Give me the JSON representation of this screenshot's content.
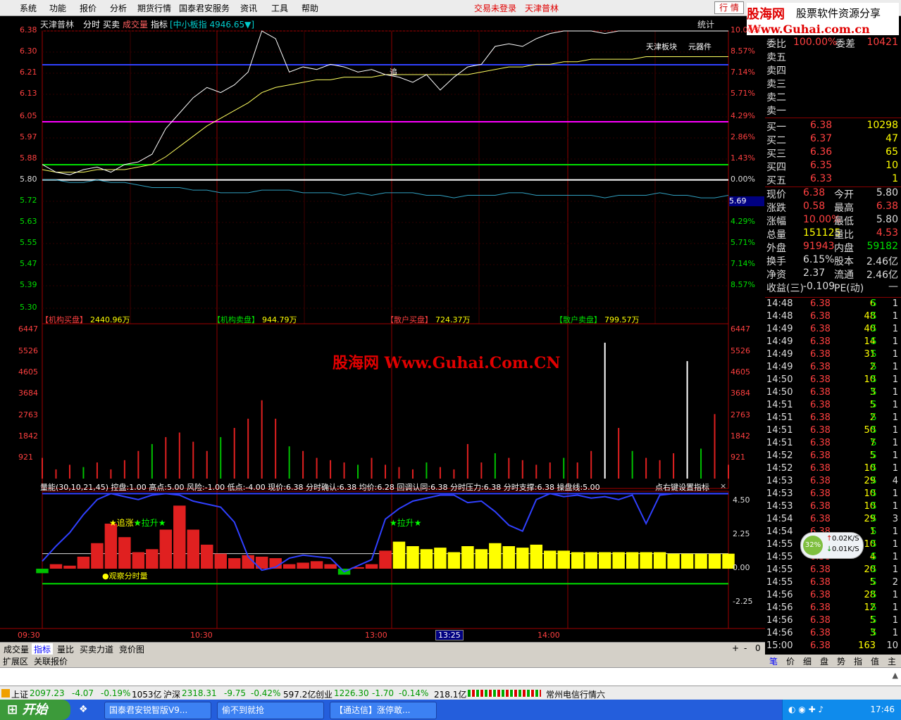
{
  "menu": {
    "items": [
      "系统",
      "功能",
      "报价",
      "分析",
      "期货行情",
      "国泰君安服务",
      "资讯",
      "工具",
      "帮助"
    ],
    "status1": "交易未登录",
    "status2": "天津普林",
    "hq_button": "行 情"
  },
  "logo": {
    "line1": "股海网",
    "line1b": "股票软件资源分享",
    "line2": "Www.Guhai.com.cn"
  },
  "chart": {
    "stock_name": "天津普林",
    "tabs": [
      "分时",
      "买卖",
      "成交量",
      "指标"
    ],
    "index_label": "[中小板指 4946.65▼]",
    "stat_label": "统计",
    "right_labels": [
      "天津板块",
      "元器件"
    ],
    "zhui": "追",
    "price_ticks": [
      "6.38",
      "6.30",
      "6.21",
      "6.13",
      "6.05",
      "5.97",
      "5.88",
      "5.80",
      "5.72",
      "5.63",
      "5.55",
      "5.47",
      "5.39",
      "5.30"
    ],
    "pct_ticks": [
      "10.00%",
      "8.57%",
      "7.14%",
      "5.71%",
      "4.29%",
      "2.86%",
      "1.43%",
      "0.00%",
      "2.86%",
      "4.29%",
      "5.71%",
      "7.14%",
      "8.57%"
    ],
    "cur_value": "5.69",
    "flows": [
      {
        "label": "【机构买盘】",
        "value": "2440.96万",
        "color": "#ff4040"
      },
      {
        "label": "【机构卖盘】",
        "value": "944.79万",
        "color": "#00e000"
      },
      {
        "label": "【散户买盘】",
        "value": "724.37万",
        "color": "#ff4040"
      },
      {
        "label": "【散户卖盘】",
        "value": "799.57万",
        "color": "#00e000"
      }
    ],
    "vol_ticks": [
      "6447",
      "5526",
      "4605",
      "3684",
      "2763",
      "1842",
      "921"
    ],
    "watermark": "股海网 Www.Guhai.Com.CN",
    "indicator_line": "量能(30,10,21,45) 控盘:1.00 高点:5.00 风险:-1.00 低点:-4.00 现价:6.38 分时确认:6.38 均价:6.28 回调认同:6.38 分时压力:6.38 分时支撑:6.38 操盘线:5.00",
    "indicator_hint": "点右键设置指标",
    "ind_ticks": [
      "4.50",
      "2.25",
      "0.00",
      "-2.25"
    ],
    "ind_labels": {
      "zhuizhang": "★追涨★",
      "lasheng1": "★拉升★",
      "lasheng2": "★拉升★",
      "guancha": "●观察分时量"
    },
    "time_labels": [
      "09:30",
      "10:30",
      "13:00",
      "13:25",
      "14:00"
    ]
  },
  "chart_data": {
    "type": "line",
    "title": "",
    "price_range": [
      5.3,
      6.38
    ],
    "prev_close": 5.8,
    "ind_range": [
      -3.4,
      5.2
    ],
    "price": [
      5.86,
      5.83,
      5.82,
      5.84,
      5.85,
      5.83,
      5.86,
      5.87,
      5.9,
      6.0,
      6.06,
      6.12,
      6.16,
      6.14,
      6.17,
      6.22,
      6.38,
      6.35,
      6.22,
      6.24,
      6.23,
      6.25,
      6.24,
      6.22,
      6.23,
      6.21,
      6.2,
      6.18,
      6.21,
      6.15,
      6.2,
      6.24,
      6.25,
      6.32,
      6.33,
      6.32,
      6.35,
      6.37,
      6.38,
      6.38,
      6.38,
      6.37,
      6.38,
      6.38,
      6.38,
      6.38,
      6.38,
      6.38,
      6.38,
      6.38,
      6.38
    ],
    "avg": [
      5.84,
      5.83,
      5.83,
      5.83,
      5.84,
      5.84,
      5.84,
      5.85,
      5.86,
      5.89,
      5.93,
      5.97,
      6.01,
      6.04,
      6.07,
      6.1,
      6.14,
      6.16,
      6.17,
      6.18,
      6.19,
      6.19,
      6.2,
      6.2,
      6.2,
      6.21,
      6.21,
      6.21,
      6.21,
      6.21,
      6.21,
      6.21,
      6.22,
      6.23,
      6.24,
      6.24,
      6.25,
      6.25,
      6.26,
      6.26,
      6.27,
      6.27,
      6.27,
      6.27,
      6.28,
      6.28,
      6.28,
      6.28,
      6.28,
      6.28,
      6.28
    ],
    "index_line": [
      5.8,
      5.8,
      5.79,
      5.79,
      5.8,
      5.79,
      5.79,
      5.78,
      5.77,
      5.77,
      5.77,
      5.76,
      5.76,
      5.75,
      5.75,
      5.75,
      5.76,
      5.76,
      5.76,
      5.75,
      5.75,
      5.75,
      5.74,
      5.75,
      5.74,
      5.75,
      5.75,
      5.75,
      5.74,
      5.74,
      5.73,
      5.74,
      5.74,
      5.74,
      5.75,
      5.75,
      5.74,
      5.74,
      5.74,
      5.74,
      5.74,
      5.73,
      5.74,
      5.74,
      5.74,
      5.75,
      5.74,
      5.74,
      5.73,
      5.73,
      5.74
    ],
    "volume": [
      900,
      400,
      600,
      500,
      700,
      400,
      800,
      1200,
      1500,
      1800,
      2000,
      1600,
      1200,
      1800,
      2200,
      2600,
      3400,
      2600,
      1400,
      1200,
      900,
      800,
      700,
      600,
      900,
      600,
      500,
      400,
      700,
      500,
      400,
      1500,
      700,
      1100,
      900,
      800,
      600,
      700,
      900,
      700,
      1200,
      5900,
      2200,
      1200,
      900,
      800,
      1100,
      5100,
      1300,
      2800,
      600
    ],
    "ind_blue": [
      0.5,
      1.5,
      2.4,
      3.6,
      4.6,
      5.0,
      4.8,
      4.6,
      4.9,
      5.0,
      4.9,
      4.5,
      4.3,
      4.1,
      3.1,
      0.8,
      -0.1,
      0.1,
      0.7,
      0.9,
      0.8,
      0.7,
      -0.2,
      0.2,
      0.6,
      3.3,
      4.0,
      4.5,
      4.7,
      4.9,
      4.9,
      4.4,
      4.5,
      3.8,
      2.9,
      2.5,
      4.6,
      5.0,
      4.8,
      4.9,
      4.7,
      4.8,
      4.6,
      4.9,
      3.0,
      4.9,
      5.0,
      5.0,
      5.0,
      5.0,
      5.0
    ],
    "ind_bars": [
      -0.3,
      0.3,
      0.2,
      0.8,
      1.7,
      3.0,
      2.1,
      1.1,
      1.3,
      2.6,
      4.2,
      2.6,
      1.6,
      1.0,
      0.7,
      0.9,
      0.8,
      0.7,
      0.3,
      0.4,
      0.5,
      0.3,
      -0.4,
      0.1,
      0.3,
      1.2,
      1.8,
      1.5,
      1.3,
      1.4,
      1.1,
      1.5,
      1.3,
      1.7,
      1.5,
      1.4,
      1.6,
      1.2,
      1.2,
      1.1,
      1.1,
      1.1,
      1.1,
      1.1,
      1.1,
      1.1,
      1.0,
      1.0,
      1.0,
      1.0,
      1.0
    ]
  },
  "quote": {
    "weibi": {
      "l1": "委比",
      "v1": "100.00%",
      "l2": "委差",
      "v2": "10421"
    },
    "asks": [
      {
        "label": "卖五",
        "price": "",
        "vol": ""
      },
      {
        "label": "卖四",
        "price": "",
        "vol": ""
      },
      {
        "label": "卖三",
        "price": "",
        "vol": ""
      },
      {
        "label": "卖二",
        "price": "",
        "vol": ""
      },
      {
        "label": "卖一",
        "price": "",
        "vol": ""
      }
    ],
    "bids": [
      {
        "label": "买一",
        "price": "6.38",
        "vol": "10298"
      },
      {
        "label": "买二",
        "price": "6.37",
        "vol": "47"
      },
      {
        "label": "买三",
        "price": "6.36",
        "vol": "65"
      },
      {
        "label": "买四",
        "price": "6.35",
        "vol": "10"
      },
      {
        "label": "买五",
        "price": "6.33",
        "vol": "1"
      }
    ],
    "stats": [
      {
        "l1": "现价",
        "v1": "6.38",
        "c1": "rd",
        "l2": "今开",
        "v2": "5.80",
        "c2": "wh"
      },
      {
        "l1": "涨跌",
        "v1": "0.58",
        "c1": "rd",
        "l2": "最高",
        "v2": "6.38",
        "c2": "rd"
      },
      {
        "l1": "涨幅",
        "v1": "10.00%",
        "c1": "rd",
        "l2": "最低",
        "v2": "5.80",
        "c2": "wh"
      },
      {
        "l1": "总量",
        "v1": "151125",
        "c1": "yel",
        "l2": "量比",
        "v2": "4.53",
        "c2": "rd"
      },
      {
        "l1": "外盘",
        "v1": "91943",
        "c1": "rd",
        "l2": "内盘",
        "v2": "59182",
        "c2": "gr"
      },
      {
        "l1": "换手",
        "v1": "6.15%",
        "c1": "wh",
        "l2": "股本",
        "v2": "2.46亿",
        "c2": "wh"
      },
      {
        "l1": "净资",
        "v1": "2.37",
        "c1": "wh",
        "l2": "流通",
        "v2": "2.46亿",
        "c2": "wh"
      },
      {
        "l1": "收益(三)",
        "v1": "-0.109",
        "c1": "wh",
        "l2": "PE(动)",
        "v2": "—",
        "c2": "wh"
      }
    ],
    "ticks": [
      {
        "t": "14:48",
        "p": "6.38",
        "v": "6",
        "s": "S",
        "n": "1"
      },
      {
        "t": "14:48",
        "p": "6.38",
        "v": "48",
        "s": "S",
        "n": "1"
      },
      {
        "t": "14:49",
        "p": "6.38",
        "v": "40",
        "s": "S",
        "n": "1"
      },
      {
        "t": "14:49",
        "p": "6.38",
        "v": "14",
        "s": "S",
        "n": "1"
      },
      {
        "t": "14:49",
        "p": "6.38",
        "v": "31",
        "s": "S",
        "n": "1"
      },
      {
        "t": "14:49",
        "p": "6.38",
        "v": "2",
        "s": "S",
        "n": "1"
      },
      {
        "t": "14:50",
        "p": "6.38",
        "v": "10",
        "s": "S",
        "n": "1"
      },
      {
        "t": "14:50",
        "p": "6.38",
        "v": "3",
        "s": "S",
        "n": "1"
      },
      {
        "t": "14:51",
        "p": "6.38",
        "v": "5",
        "s": "S",
        "n": "1"
      },
      {
        "t": "14:51",
        "p": "6.38",
        "v": "2",
        "s": "S",
        "n": "1"
      },
      {
        "t": "14:51",
        "p": "6.38",
        "v": "50",
        "s": "S",
        "n": "1"
      },
      {
        "t": "14:51",
        "p": "6.38",
        "v": "7",
        "s": "S",
        "n": "1"
      },
      {
        "t": "14:52",
        "p": "6.38",
        "v": "5",
        "s": "S",
        "n": "1"
      },
      {
        "t": "14:52",
        "p": "6.38",
        "v": "10",
        "s": "S",
        "n": "1"
      },
      {
        "t": "14:53",
        "p": "6.38",
        "v": "29",
        "s": "S",
        "n": "4"
      },
      {
        "t": "14:53",
        "p": "6.38",
        "v": "10",
        "s": "S",
        "n": "1"
      },
      {
        "t": "14:53",
        "p": "6.38",
        "v": "10",
        "s": "S",
        "n": "1"
      },
      {
        "t": "14:54",
        "p": "6.38",
        "v": "29",
        "s": "S",
        "n": "3"
      },
      {
        "t": "14:54",
        "p": "6.38",
        "v": "1",
        "s": "S",
        "n": "1"
      },
      {
        "t": "14:55",
        "p": "6.38",
        "v": "10",
        "s": "S",
        "n": "1"
      },
      {
        "t": "14:55",
        "p": "6.38",
        "v": "4",
        "s": "S",
        "n": "1"
      },
      {
        "t": "14:55",
        "p": "6.38",
        "v": "20",
        "s": "S",
        "n": "1"
      },
      {
        "t": "14:55",
        "p": "6.38",
        "v": "5",
        "s": "S",
        "n": "2"
      },
      {
        "t": "14:56",
        "p": "6.38",
        "v": "28",
        "s": "S",
        "n": "1"
      },
      {
        "t": "14:56",
        "p": "6.38",
        "v": "12",
        "s": "S",
        "n": "1"
      },
      {
        "t": "14:56",
        "p": "6.38",
        "v": "5",
        "s": "S",
        "n": "1"
      },
      {
        "t": "14:56",
        "p": "6.38",
        "v": "3",
        "s": "S",
        "n": "1"
      },
      {
        "t": "15:00",
        "p": "6.38",
        "v": "163",
        "s": "",
        "n": "10"
      }
    ]
  },
  "net": {
    "pct": "32%",
    "up": "0.02K/S",
    "down": "0.01K/S"
  },
  "bottom_tabs": [
    "成交量",
    "指标",
    "量比",
    "买卖力道",
    "竞价图"
  ],
  "bottom_tabs2": [
    "扩展区",
    "关联报价"
  ],
  "rp_tabs": [
    "笔",
    "价",
    "细",
    "盘",
    "势",
    "指",
    "值",
    "主"
  ],
  "status": {
    "sh": {
      "name": "上证",
      "val": "2097.23",
      "chg": "-4.07",
      "pct": "-0.19%",
      "amt": "1053亿"
    },
    "hs": {
      "name": "沪深",
      "val": "2318.31",
      "chg": "-9.75",
      "pct": "-0.42%",
      "amt": "597.2亿"
    },
    "cy": {
      "name": "创业",
      "val": "1226.30",
      "chg": "-1.70",
      "pct": "-0.14%",
      "amt": "218.1亿"
    },
    "ticker": "常州电信行情六"
  },
  "taskbar": {
    "start": "开始",
    "tasks": [
      "国泰君安锐智版V9...",
      "偷不到就抢",
      "【通达信】涨停敢..."
    ],
    "clock": "17:46"
  }
}
